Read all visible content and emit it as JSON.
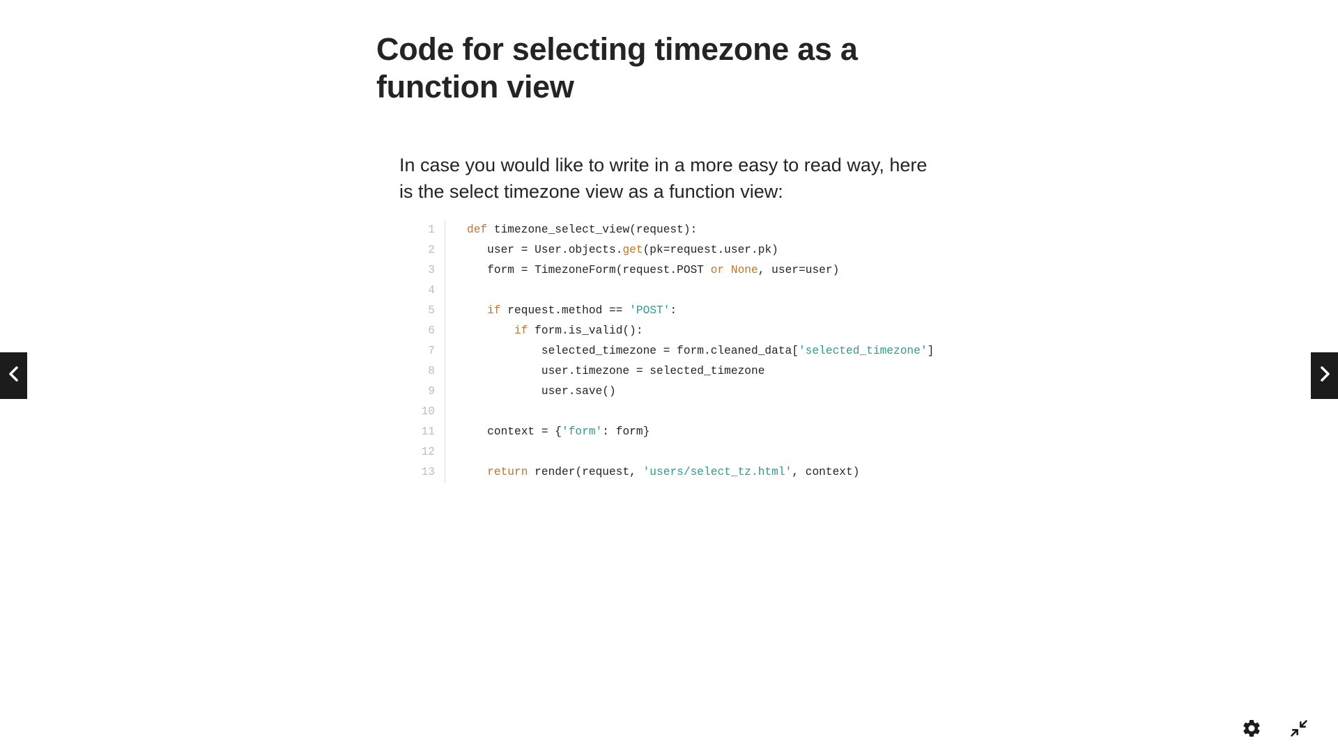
{
  "slide": {
    "title": "Code for selecting timezone as a function view",
    "intro": "In case you would like to write in a more easy to read way, here is the select timezone view as a function view:"
  },
  "code": {
    "lines": [
      {
        "n": "1",
        "tokens": [
          {
            "t": "def",
            "c": "kw"
          },
          {
            "t": " timezone_select_view(request):"
          }
        ]
      },
      {
        "n": "2",
        "tokens": [
          {
            "t": "   user = User.objects."
          },
          {
            "t": "get",
            "c": "kw"
          },
          {
            "t": "(pk=request.user.pk)"
          }
        ]
      },
      {
        "n": "3",
        "tokens": [
          {
            "t": "   form = TimezoneForm(request.POST "
          },
          {
            "t": "or",
            "c": "kw"
          },
          {
            "t": " "
          },
          {
            "t": "None",
            "c": "kw"
          },
          {
            "t": ", user=user)"
          }
        ]
      },
      {
        "n": "4",
        "tokens": [
          {
            "t": ""
          }
        ]
      },
      {
        "n": "5",
        "tokens": [
          {
            "t": "   "
          },
          {
            "t": "if",
            "c": "kw"
          },
          {
            "t": " request.method == "
          },
          {
            "t": "'POST'",
            "c": "str"
          },
          {
            "t": ":"
          }
        ]
      },
      {
        "n": "6",
        "tokens": [
          {
            "t": "       "
          },
          {
            "t": "if",
            "c": "kw"
          },
          {
            "t": " form.is_valid():"
          }
        ]
      },
      {
        "n": "7",
        "tokens": [
          {
            "t": "           selected_timezone = form.cleaned_data["
          },
          {
            "t": "'selected_timezone'",
            "c": "str"
          },
          {
            "t": "]"
          }
        ]
      },
      {
        "n": "8",
        "tokens": [
          {
            "t": "           user.timezone = selected_timezone"
          }
        ]
      },
      {
        "n": "9",
        "tokens": [
          {
            "t": "           user.save()"
          }
        ]
      },
      {
        "n": "10",
        "tokens": [
          {
            "t": ""
          }
        ]
      },
      {
        "n": "11",
        "tokens": [
          {
            "t": "   context = {"
          },
          {
            "t": "'form'",
            "c": "str"
          },
          {
            "t": ": form}"
          }
        ]
      },
      {
        "n": "12",
        "tokens": [
          {
            "t": ""
          }
        ]
      },
      {
        "n": "13",
        "tokens": [
          {
            "t": "   "
          },
          {
            "t": "return",
            "c": "kw"
          },
          {
            "t": " render(request, "
          },
          {
            "t": "'users/select_tz.html'",
            "c": "str"
          },
          {
            "t": ", context)"
          }
        ]
      }
    ]
  },
  "controls": {
    "prev_icon": "chevron-left-icon",
    "next_icon": "chevron-right-icon",
    "settings_icon": "gear-icon",
    "collapse_icon": "collapse-icon"
  },
  "colors": {
    "text": "#242424",
    "keyword": "#c0762a",
    "string": "#2a9d8f",
    "line_number": "#bdbdbd",
    "nav_background": "#1c1c1c"
  }
}
